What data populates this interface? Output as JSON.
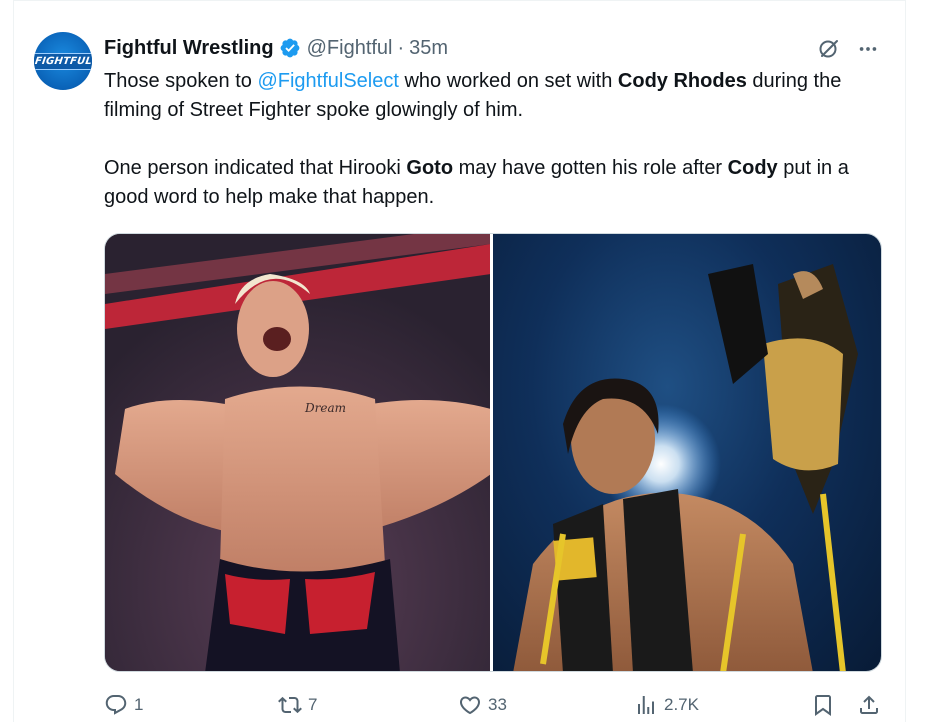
{
  "tweet": {
    "author_name": "Fightful Wrestling",
    "handle": "@Fightful",
    "separator": "·",
    "time": "35m",
    "avatar_text": "FIGHTFUL",
    "paragraph1": {
      "t1": "Those spoken to ",
      "mention": "@FightfulSelect",
      "t2": " who worked on set with ",
      "bold1": "Cody Rhodes",
      "t3": " during the filming of Street Fighter spoke glowingly of him."
    },
    "paragraph2": {
      "t1": "One person indicated that Hirooki ",
      "bold1": "Goto",
      "t2": " may have gotten his role after ",
      "bold2": "Cody",
      "t3": " put in a good word to help make that happen."
    },
    "images": [
      {
        "subject": "wrestler with blond hair posing shirtless in arena"
      },
      {
        "subject": "wrestler holding championship belt aloft"
      }
    ],
    "stats": {
      "replies": "1",
      "reposts": "7",
      "likes": "33",
      "views": "2.7K"
    }
  },
  "icons": {
    "verified": "verified-badge-icon",
    "grok": "grok-icon",
    "more": "more-icon",
    "reply": "reply-icon",
    "repost": "repost-icon",
    "like": "like-icon",
    "views": "views-icon",
    "bookmark": "bookmark-icon",
    "share": "share-icon"
  },
  "colors": {
    "accent": "#1d9bf0",
    "secondary_text": "#536471",
    "primary_text": "#0f1419"
  }
}
